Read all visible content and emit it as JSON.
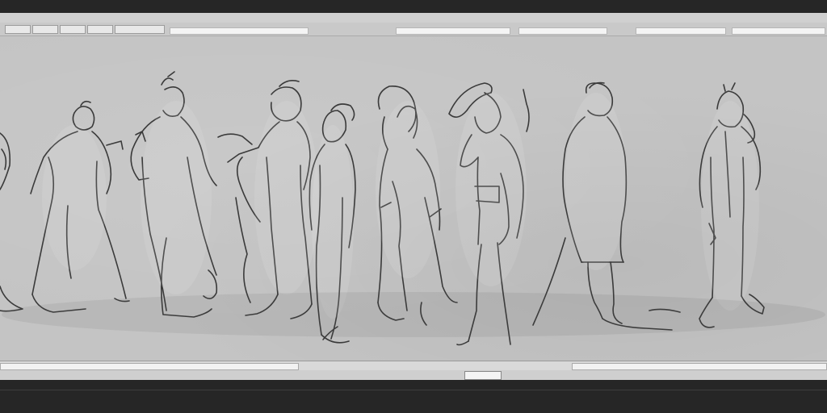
{
  "window": {
    "title": "",
    "right_title": ""
  },
  "menu": {
    "items": [
      "",
      "",
      "",
      "",
      "",
      "",
      ""
    ]
  },
  "status": {
    "left_text": "",
    "center_text": ""
  },
  "colors": {
    "canvas": "#c4c4c4",
    "ink": "#3a3a3a",
    "chrome": "#262626"
  }
}
